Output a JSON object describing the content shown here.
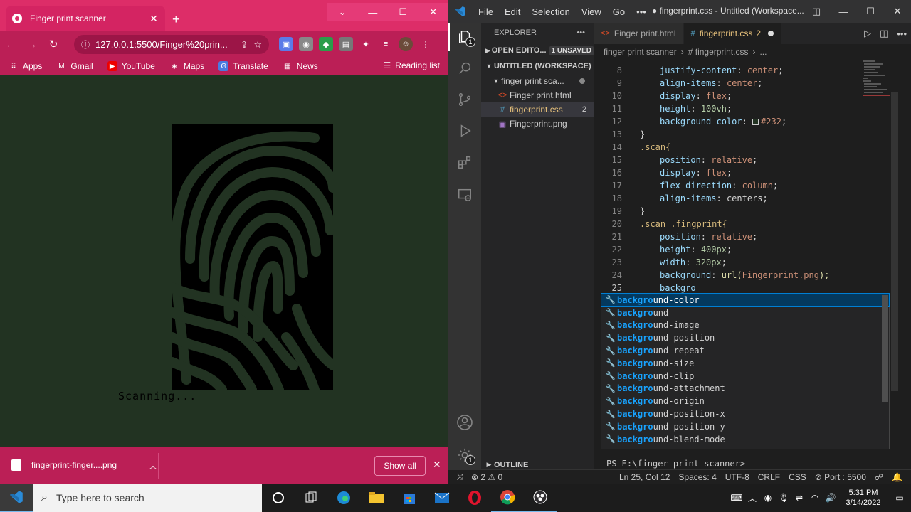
{
  "browser": {
    "tab_title": "Finger print scanner",
    "url": "127.0.0.1:5500/Finger%20prin...",
    "bookmarks": [
      "Apps",
      "Gmail",
      "YouTube",
      "Maps",
      "Translate",
      "News"
    ],
    "reading_list": "Reading list",
    "page": {
      "status_text": "Scanning..."
    },
    "download": {
      "filename": "fingerprint-finger....png",
      "show_all": "Show all"
    }
  },
  "vscode": {
    "menu": [
      "File",
      "Edit",
      "Selection",
      "View",
      "Go"
    ],
    "more_menu": "•••",
    "window_title": "● fingerprint.css - Untitled (Workspace...",
    "explorer": {
      "title": "EXPLORER",
      "open_editors": "OPEN EDITO...",
      "unsaved": "1 UNSAVED",
      "workspace": "UNTITLED (WORKSPACE)",
      "folder": "finger print sca...",
      "files": [
        {
          "name": "Finger print.html",
          "icon": "html-file-icon"
        },
        {
          "name": "fingerprint.css",
          "icon": "css-file-icon",
          "count": "2"
        },
        {
          "name": "Fingerprint.png",
          "icon": "image-file-icon"
        }
      ],
      "outline": "OUTLINE"
    },
    "tabs": [
      {
        "label": "Finger print.html",
        "icon": "html-file-icon"
      },
      {
        "label": "fingerprint.css",
        "icon": "css-file-icon",
        "count": "2"
      }
    ],
    "breadcrumb": [
      "finger print scanner",
      "# fingerprint.css",
      "..."
    ],
    "line_numbers": [
      "8",
      "9",
      "10",
      "11",
      "12",
      "13",
      "14",
      "15",
      "16",
      "17",
      "18",
      "19",
      "20",
      "21",
      "22",
      "23",
      "24",
      "25"
    ],
    "code": {
      "l8": [
        "justify-content",
        "center"
      ],
      "l9": [
        "align-items",
        "center"
      ],
      "l10": [
        "display",
        "flex"
      ],
      "l11": [
        "height",
        "100vh"
      ],
      "l12": [
        "background-color",
        "#232"
      ],
      "l14": ".scan{",
      "l15": [
        "position",
        "relative"
      ],
      "l16": [
        "display",
        "flex"
      ],
      "l17": [
        "flex-direction",
        "column"
      ],
      "l18": [
        "align-items",
        "centers"
      ],
      "l20": ".scan .fingprint{",
      "l21": [
        "position",
        "relative"
      ],
      "l22": [
        "height",
        "400px"
      ],
      "l23": [
        "width",
        "320px"
      ],
      "l24": [
        "background",
        "url(",
        "Fingerprint.png",
        ");"
      ],
      "l25": "backgro",
      "close": "}"
    },
    "suggestions": [
      {
        "match": "backgro",
        "rest": "und-color"
      },
      {
        "match": "backgro",
        "rest": "und"
      },
      {
        "match": "backgro",
        "rest": "und-image"
      },
      {
        "match": "backgro",
        "rest": "und-position"
      },
      {
        "match": "backgro",
        "rest": "und-repeat"
      },
      {
        "match": "backgro",
        "rest": "und-size"
      },
      {
        "match": "backgro",
        "rest": "und-clip"
      },
      {
        "match": "backgro",
        "rest": "und-attachment"
      },
      {
        "match": "backgro",
        "rest": "und-origin"
      },
      {
        "match": "backgro",
        "rest": "und-position-x"
      },
      {
        "match": "backgro",
        "rest": "und-position-y"
      },
      {
        "match": "backgro",
        "rest": "und-blend-mode"
      }
    ],
    "terminal_prompt": "PS E:\\finger print scanner>",
    "status": {
      "errors": "⊗ 2 ⚠ 0",
      "position": "Ln 25, Col 12",
      "spaces": "Spaces: 4",
      "encoding": "UTF-8",
      "eol": "CRLF",
      "language": "CSS",
      "port": "⊘ Port : 5500"
    }
  },
  "taskbar": {
    "search_placeholder": "Type here to search",
    "time": "5:31 PM",
    "date": "3/14/2022"
  },
  "colors": {
    "page_background": "#223322",
    "browser_theme": "#bb1f56",
    "vscode_accent": "#007fd4"
  }
}
